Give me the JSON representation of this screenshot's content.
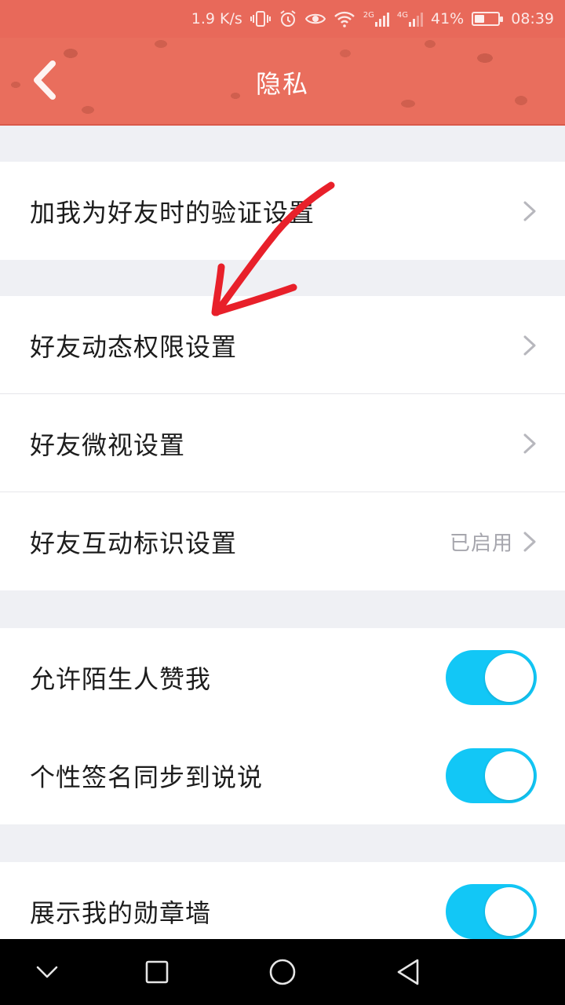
{
  "status_bar": {
    "network_speed": "1.9 K/s",
    "sim1_type": "2G",
    "sim2_type": "4G",
    "battery_percent": "41%",
    "battery_level": 0.41,
    "time": "08:39"
  },
  "header": {
    "title": "隐私",
    "back_icon": "chevron-left-icon",
    "background_color": "#e96e5d"
  },
  "groups": [
    {
      "rows": [
        {
          "label": "加我为好友时的验证设置",
          "type": "link"
        }
      ]
    },
    {
      "rows": [
        {
          "label": "好友动态权限设置",
          "type": "link"
        },
        {
          "label": "好友微视设置",
          "type": "link"
        },
        {
          "label": "好友互动标识设置",
          "type": "link",
          "value": "已启用"
        }
      ]
    },
    {
      "rows": [
        {
          "label": "允许陌生人赞我",
          "type": "toggle",
          "on": true
        },
        {
          "label": "个性签名同步到说说",
          "type": "toggle",
          "on": true
        }
      ]
    },
    {
      "rows": [
        {
          "label": "展示我的勋章墙",
          "type": "toggle",
          "on": true
        }
      ]
    }
  ],
  "toggle_color": "#12c7f6",
  "annotation": {
    "type": "hand-drawn-arrow",
    "color": "#e8202a"
  },
  "nav_bar": {
    "buttons": [
      "chevron-down-icon",
      "square-icon",
      "circle-icon",
      "triangle-back-icon"
    ]
  }
}
